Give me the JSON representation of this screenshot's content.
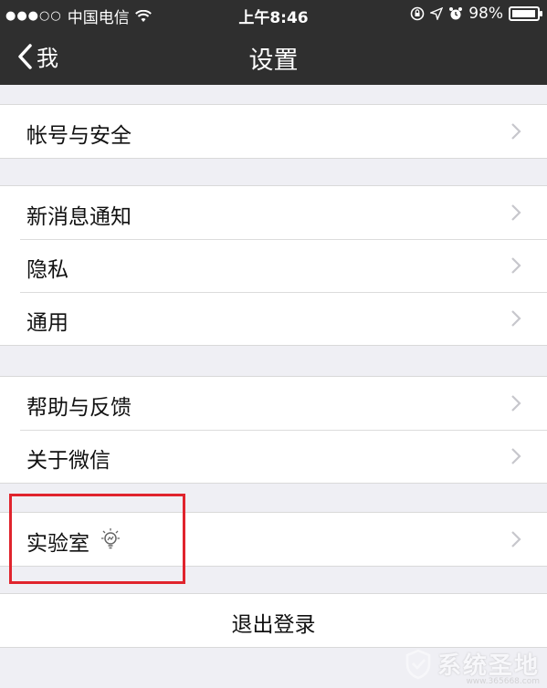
{
  "status": {
    "signal_dots": "●●●○○",
    "carrier": "中国电信",
    "time": "上午8:46",
    "battery": "98%",
    "battery_fraction": 0.98
  },
  "nav": {
    "back_label": "我",
    "title": "设置"
  },
  "groups": [
    {
      "items": [
        {
          "label": "帐号与安全"
        }
      ]
    },
    {
      "items": [
        {
          "label": "新消息通知"
        },
        {
          "label": "隐私"
        },
        {
          "label": "通用"
        }
      ]
    },
    {
      "items": [
        {
          "label": "帮助与反馈"
        },
        {
          "label": "关于微信"
        }
      ]
    },
    {
      "items": [
        {
          "label": "实验室",
          "icon": "lightbulb-icon"
        }
      ]
    }
  ],
  "logout_label": "退出登录",
  "watermark": {
    "text": "系统圣地",
    "sub": "www.365668.com"
  },
  "colors": {
    "bar": "#2f2f2f",
    "background": "#efeff4",
    "highlight": "#e0242d"
  }
}
